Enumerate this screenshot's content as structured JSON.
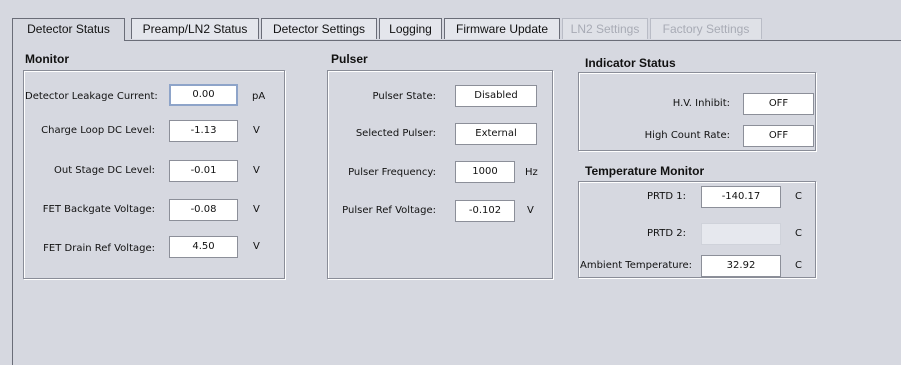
{
  "tabs": [
    {
      "label": "Detector Status",
      "state": "active"
    },
    {
      "label": "Preamp/LN2 Status",
      "state": "normal"
    },
    {
      "label": "Detector Settings",
      "state": "normal"
    },
    {
      "label": "Logging",
      "state": "normal"
    },
    {
      "label": "Firmware Update",
      "state": "normal"
    },
    {
      "label": "LN2 Settings",
      "state": "disabled"
    },
    {
      "label": "Factory Settings",
      "state": "disabled"
    }
  ],
  "monitor": {
    "title": "Monitor",
    "rows": [
      {
        "label": "Detector Leakage Current:",
        "value": "0.00",
        "unit": "pA"
      },
      {
        "label": "Charge Loop DC Level:",
        "value": "-1.13",
        "unit": "V"
      },
      {
        "label": "Out Stage DC Level:",
        "value": "-0.01",
        "unit": "V"
      },
      {
        "label": "FET Backgate Voltage:",
        "value": "-0.08",
        "unit": "V"
      },
      {
        "label": "FET Drain Ref Voltage:",
        "value": "4.50",
        "unit": "V"
      }
    ]
  },
  "pulser": {
    "title": "Pulser",
    "rows": [
      {
        "label": "Pulser State:",
        "value": "Disabled",
        "unit": ""
      },
      {
        "label": "Selected Pulser:",
        "value": "External",
        "unit": ""
      },
      {
        "label": "Pulser Frequency:",
        "value": "1000",
        "unit": "Hz"
      },
      {
        "label": "Pulser Ref Voltage:",
        "value": "-0.102",
        "unit": "V"
      }
    ]
  },
  "indicator": {
    "title": "Indicator Status",
    "rows": [
      {
        "label": "H.V. Inhibit:",
        "value": "OFF"
      },
      {
        "label": "High Count Rate:",
        "value": "OFF"
      }
    ]
  },
  "temperature": {
    "title": "Temperature Monitor",
    "rows": [
      {
        "label": "PRTD 1:",
        "value": "-140.17",
        "unit": "C"
      },
      {
        "label": "PRTD 2:",
        "value": "",
        "unit": "C"
      },
      {
        "label": "Ambient Temperature:",
        "value": "32.92",
        "unit": "C"
      }
    ]
  }
}
